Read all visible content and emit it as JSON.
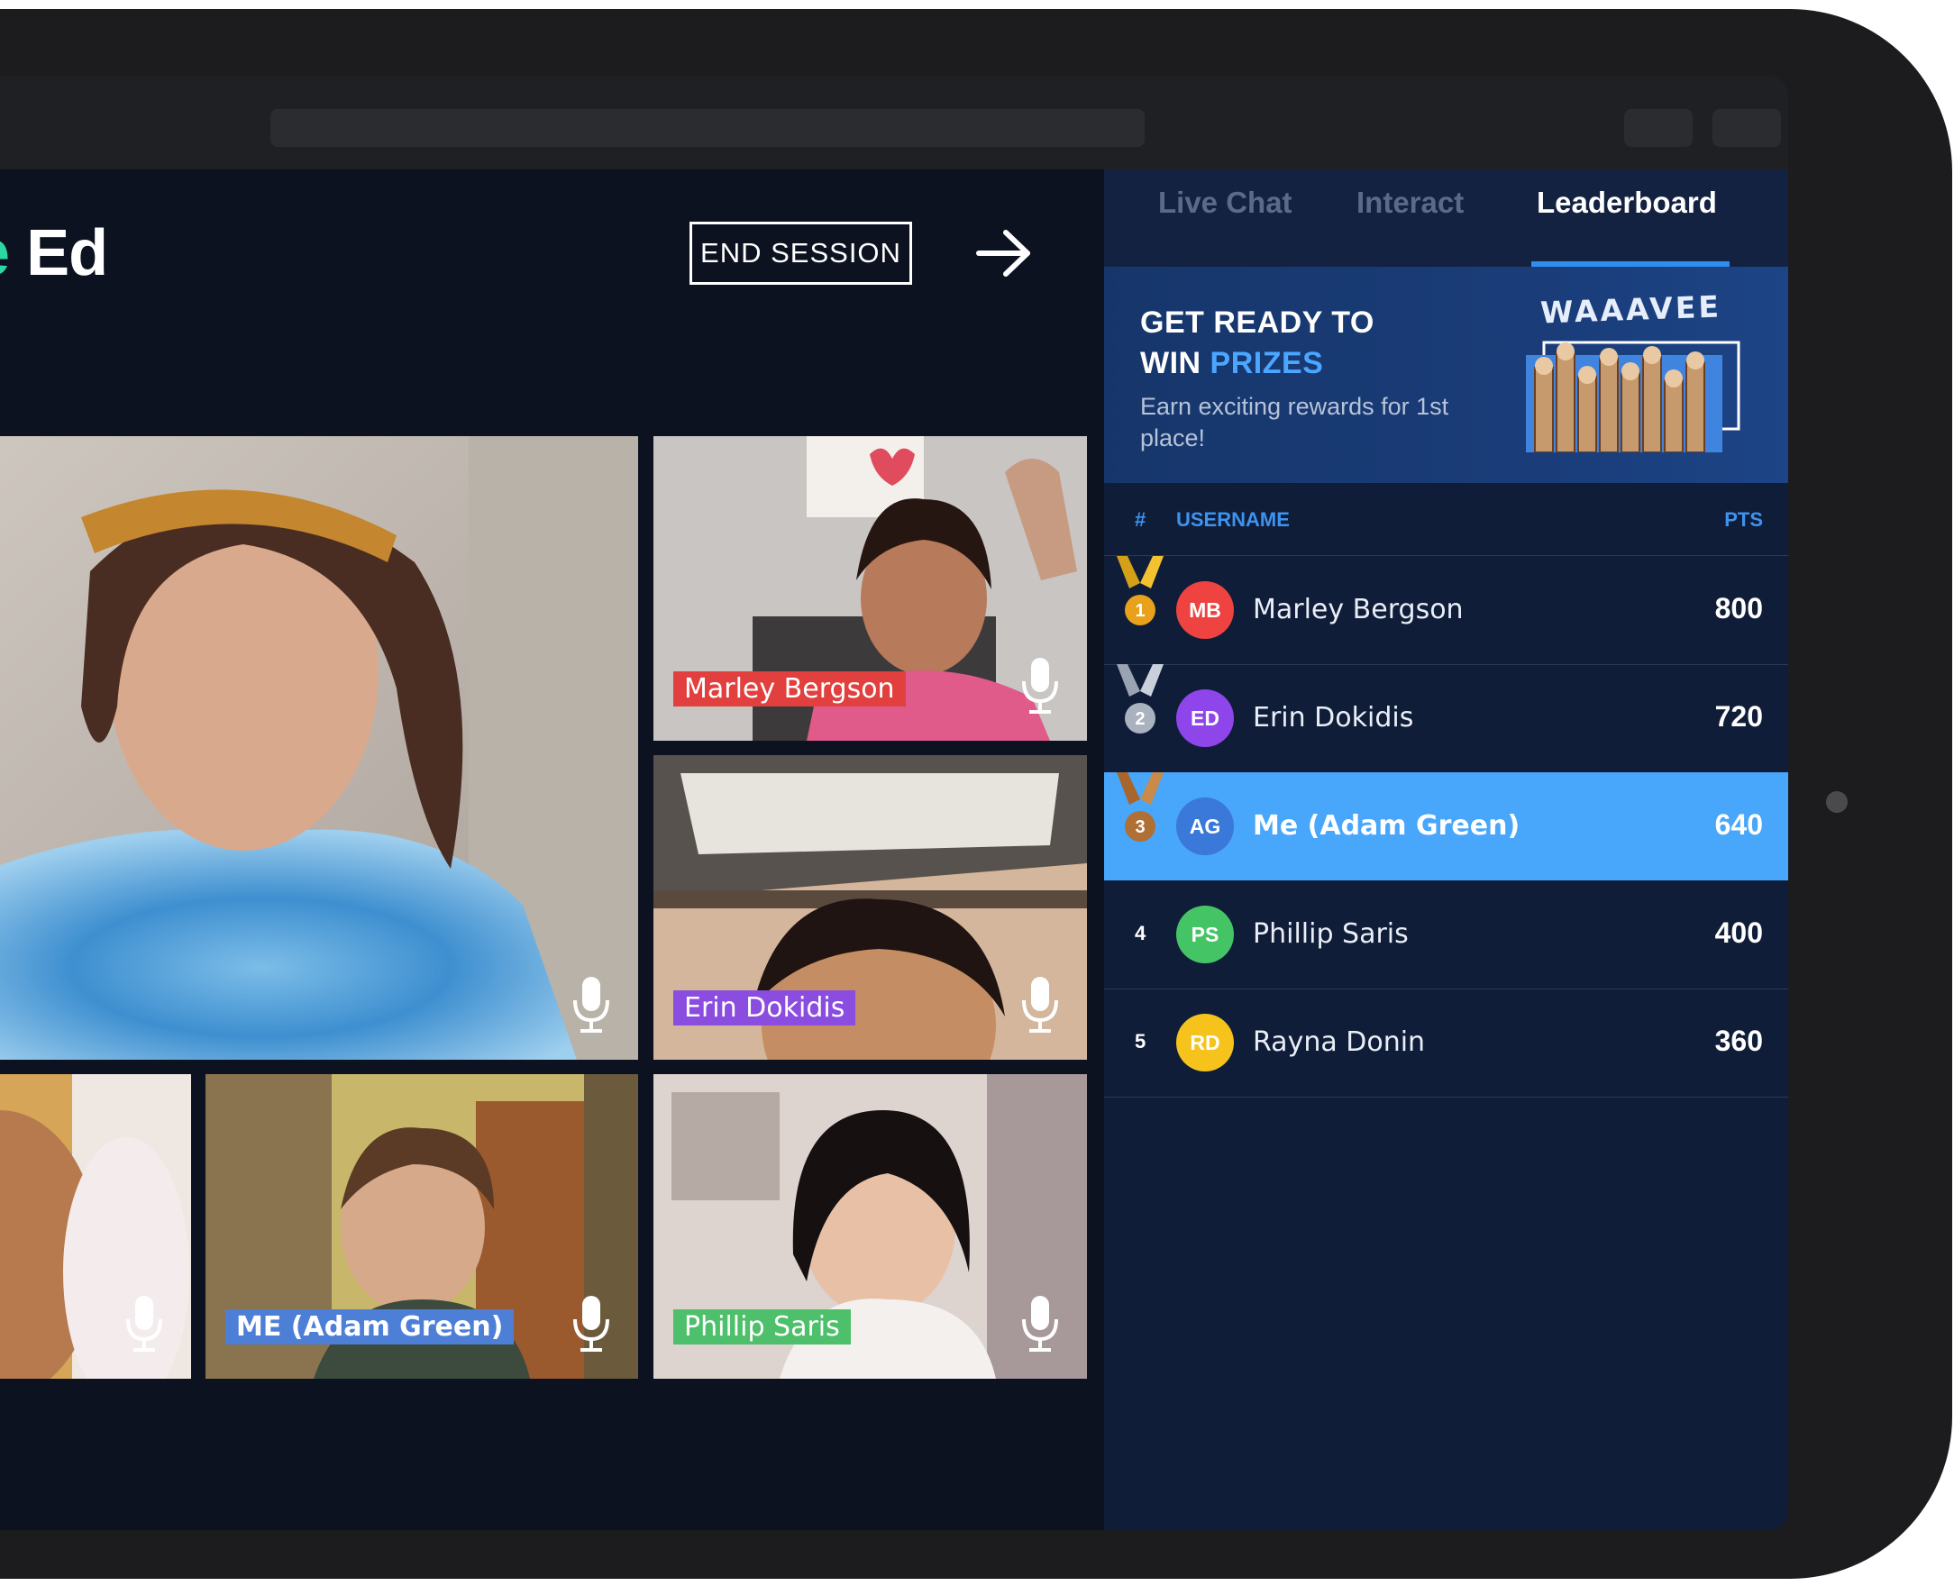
{
  "header": {
    "logo_prefix": "ke",
    "logo_suffix": " Ed",
    "end_session_label": "END SESSION",
    "next_icon": "arrow-right-icon"
  },
  "videos": [
    {
      "name": ""
    },
    {
      "name": "Marley Bergson",
      "tag_color": "#e2403e"
    },
    {
      "name": "Erin Dokidis",
      "tag_color": "#8b4ce0"
    },
    {
      "name": ""
    },
    {
      "name": "ME (Adam Green)",
      "tag_color": "#4d7fd6"
    },
    {
      "name": "Phillip Saris",
      "tag_color": "#4ec06b"
    }
  ],
  "panel": {
    "tabs": [
      {
        "label": "Live Chat",
        "active": false
      },
      {
        "label": "Interact",
        "active": false
      },
      {
        "label": "Leaderboard",
        "active": true
      }
    ],
    "promo": {
      "title_line1": "GET READY TO",
      "title_line2_prefix": "WIN ",
      "title_line2_highlight": "PRIZES",
      "subtitle": "Earn exciting rewards for 1st place!",
      "brand": "WAAAVEE"
    },
    "columns": {
      "rank": "#",
      "username": "USERNAME",
      "points": "PTS"
    },
    "leaderboard": [
      {
        "rank": "1",
        "initials": "MB",
        "name": "Marley Bergson",
        "points": "800",
        "avatar_color": "#ee4340",
        "medal": "gold"
      },
      {
        "rank": "2",
        "initials": "ED",
        "name": "Erin Dokidis",
        "points": "720",
        "avatar_color": "#8e45ea",
        "medal": "silver"
      },
      {
        "rank": "3",
        "initials": "AG",
        "name": "Me (Adam Green)",
        "points": "640",
        "avatar_color": "#3a78d9",
        "medal": "bronze",
        "highlight": true
      },
      {
        "rank": "4",
        "initials": "PS",
        "name": "Phillip Saris",
        "points": "400",
        "avatar_color": "#45c466"
      },
      {
        "rank": "5",
        "initials": "RD",
        "name": "Rayna Donin",
        "points": "360",
        "avatar_color": "#f5c31b"
      }
    ]
  },
  "colors": {
    "accent_teal": "#2bd7a2",
    "tab_active_underline": "#2f8ff0",
    "highlight_row": "#48a6fb"
  }
}
